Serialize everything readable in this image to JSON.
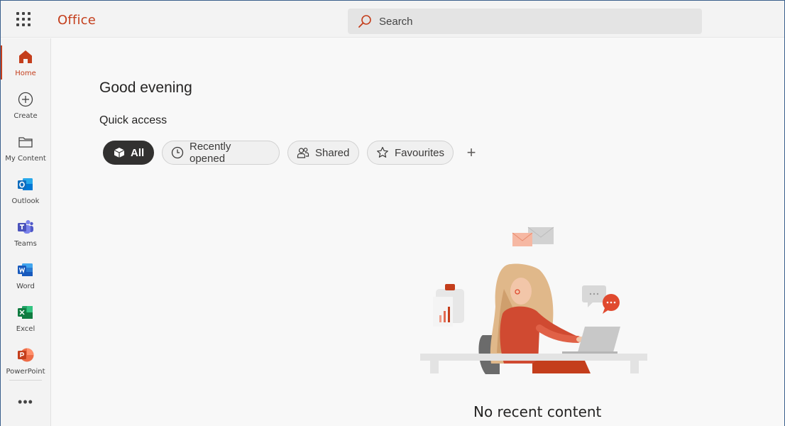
{
  "app": {
    "brand": "Office"
  },
  "search": {
    "placeholder": "Search"
  },
  "rail": {
    "items": [
      {
        "label": "Home",
        "icon": "home-icon",
        "active": true
      },
      {
        "label": "Create",
        "icon": "create-icon"
      },
      {
        "label": "My Content",
        "icon": "folder-icon"
      },
      {
        "label": "Outlook",
        "icon": "outlook-icon"
      },
      {
        "label": "Teams",
        "icon": "teams-icon"
      },
      {
        "label": "Word",
        "icon": "word-icon"
      },
      {
        "label": "Excel",
        "icon": "excel-icon"
      },
      {
        "label": "PowerPoint",
        "icon": "powerpoint-icon"
      }
    ],
    "more": "•••"
  },
  "main": {
    "greeting": "Good evening",
    "quick_access": "Quick access",
    "chips": [
      {
        "label": "All",
        "icon": "cube-icon",
        "active": true
      },
      {
        "label": "Recently opened",
        "icon": "clock-icon"
      },
      {
        "label": "Shared",
        "icon": "people-icon"
      },
      {
        "label": "Favourites",
        "icon": "star-icon"
      }
    ],
    "add_symbol": "+",
    "empty_message": "No recent content"
  },
  "colors": {
    "brand": "#c43e1c",
    "outlook": "#0f6cbd",
    "teams": "#5b5fc7",
    "word": "#185abd",
    "excel": "#107c41",
    "powerpoint": "#c43e1c"
  }
}
